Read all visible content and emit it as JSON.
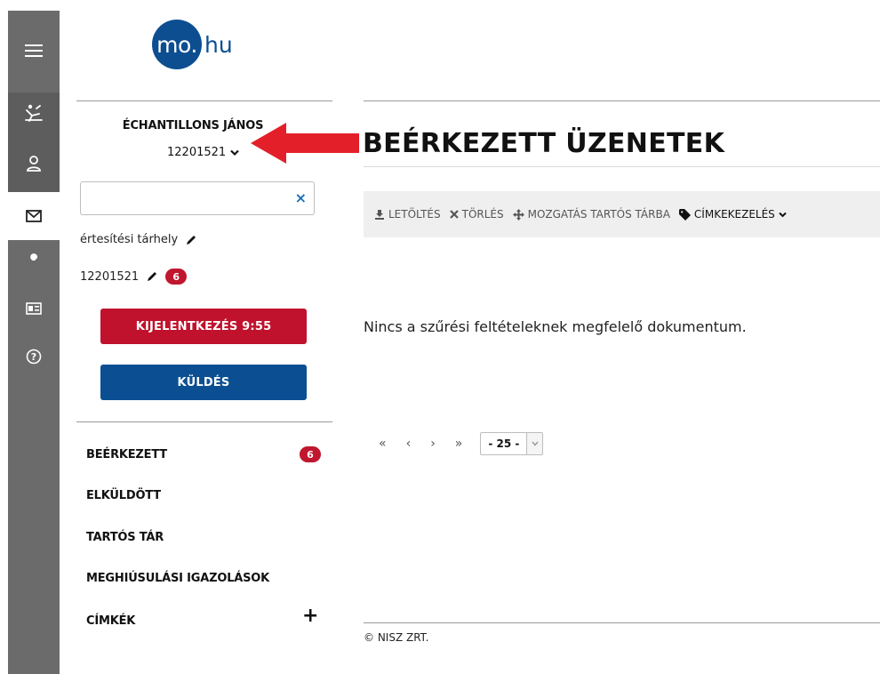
{
  "logo": {
    "circle": "mo.",
    "tail": "hu"
  },
  "rail": {
    "icons": [
      "menu-icon",
      "relax-icon",
      "user-icon",
      "mail-icon",
      "wrench-icon",
      "id-card-icon",
      "help-icon"
    ]
  },
  "sidebar": {
    "user_name": "ÉCHANTILLONS JÁNOS",
    "user_id": "12201521",
    "search": {
      "value": "",
      "placeholder": ""
    },
    "clear_symbol": "×",
    "storage_label": "értesítési tárhely",
    "storage_id": "12201521",
    "storage_badge": "6",
    "logout_label": "KIJELENTKEZÉS 9:55",
    "send_label": "KÜLDÉS",
    "nav": {
      "inbox": "BEÉRKEZETT",
      "inbox_badge": "6",
      "sent": "ELKÜLDÖTT",
      "archive": "TARTÓS TÁR",
      "failures": "MEGHIÚSULÁSI IGAZOLÁSOK",
      "labels": "CÍMKÉK",
      "labels_add": "+"
    }
  },
  "main": {
    "title": "BEÉRKEZETT ÜZENETEK",
    "toolbar": {
      "download": "LETÖLTÉS",
      "delete": "TÖRLÉS",
      "move": "MOZGATÁS TARTÓS TÁRBA",
      "labels": "CÍMKEKEZELÉS"
    },
    "empty_message": "Nincs a szűrési feltételeknek megfelelő dokumentum.",
    "pager": {
      "first": "«",
      "prev": "‹",
      "next": "›",
      "last": "»",
      "per_page": "- 25 -"
    },
    "footer": "© NISZ ZRT."
  },
  "colors": {
    "brand_blue": "#0d4e91",
    "danger_red": "#c0122d",
    "rail_gray": "#6b6b6b",
    "annotation_arrow": "#e3202a"
  }
}
